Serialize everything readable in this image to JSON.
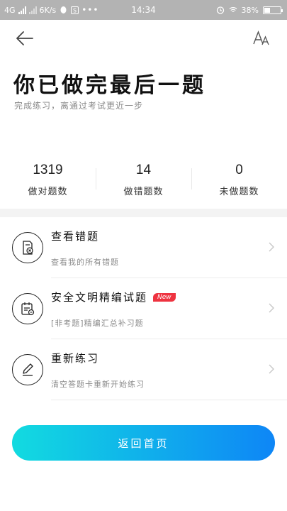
{
  "status_bar": {
    "network": "4G",
    "speed": "6K/s",
    "time": "14:34",
    "battery": "38%",
    "battery_level": 0.38
  },
  "header": {
    "title": "你已做完最后一题",
    "subtitle": "完成练习，离通过考试更近一步"
  },
  "stats": [
    {
      "value": "1319",
      "label": "做对题数"
    },
    {
      "value": "14",
      "label": "做错题数"
    },
    {
      "value": "0",
      "label": "未做题数"
    }
  ],
  "menu": [
    {
      "label": "查看错题",
      "desc": "查看我的所有错题",
      "icon": "wrong-questions-icon"
    },
    {
      "label": "安全文明精编试题",
      "badge": "New",
      "desc": "[非考题]精编汇总补习题",
      "icon": "calendar-icon"
    },
    {
      "label": "重新练习",
      "desc": "清空答题卡重新开始练习",
      "icon": "pencil-icon"
    }
  ],
  "home_button": "返回首页",
  "colors": {
    "status_bar": "#b3b3b3",
    "button_start": "#12dbe0",
    "button_end": "#0e86f6",
    "badge": "#ee3340"
  }
}
